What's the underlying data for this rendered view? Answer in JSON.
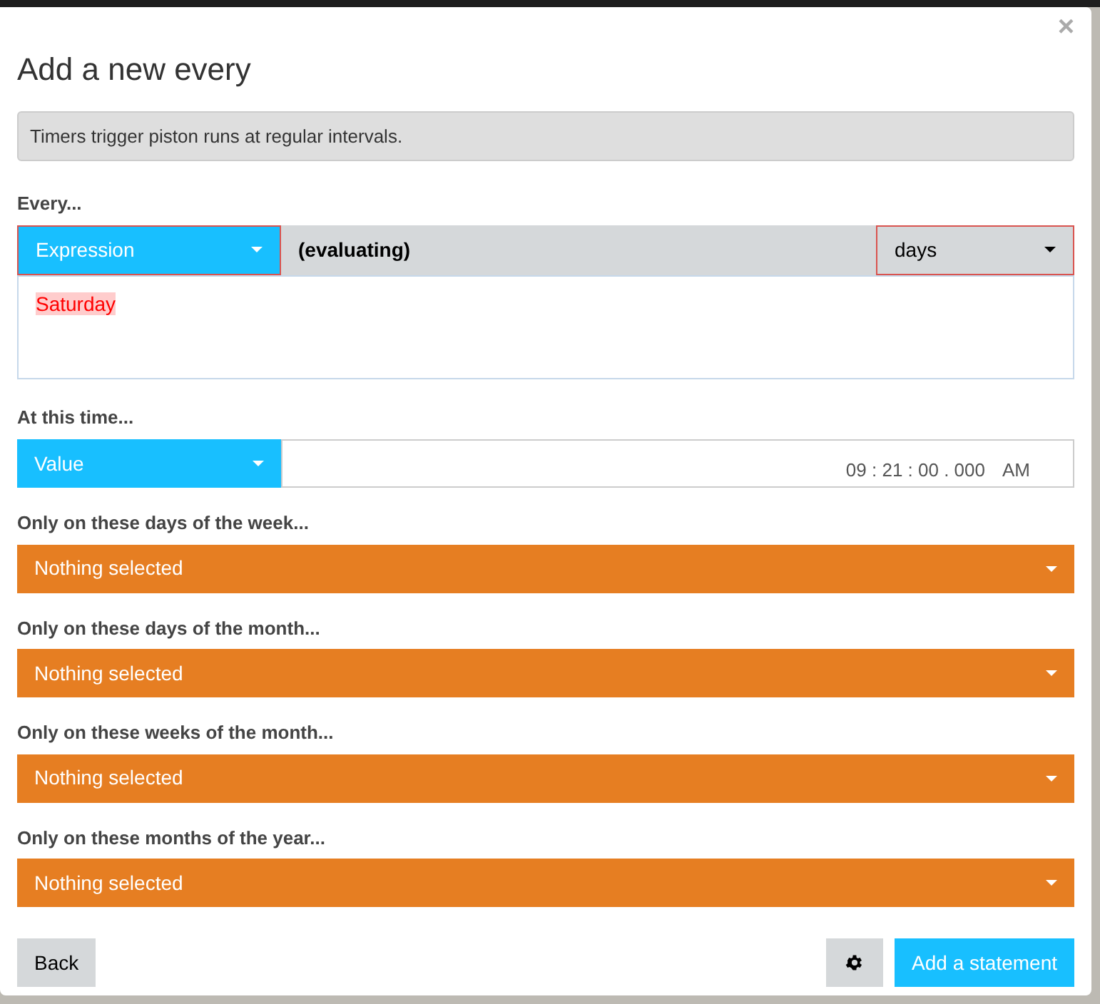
{
  "dialog": {
    "title": "Add a new every",
    "close": "×",
    "info": "Timers trigger piston runs at regular intervals."
  },
  "every": {
    "label": "Every...",
    "type_select": "Expression",
    "expression": "(evaluating)",
    "unit_select": "days",
    "invalid": true,
    "suggestions": [
      {
        "text": "Saturday",
        "error": true
      }
    ]
  },
  "time": {
    "label": "At this time...",
    "type_select": "Value",
    "value": "09 : 21 : 00 . 000",
    "period": "AM"
  },
  "filters": [
    {
      "label": "Only on these days of the week...",
      "value": "Nothing selected"
    },
    {
      "label": "Only on these days of the month...",
      "value": "Nothing selected"
    },
    {
      "label": "Only on these weeks of the month...",
      "value": "Nothing selected"
    },
    {
      "label": "Only on these months of the year...",
      "value": "Nothing selected"
    }
  ],
  "buttons": {
    "back": "Back",
    "add": "Add a statement"
  }
}
